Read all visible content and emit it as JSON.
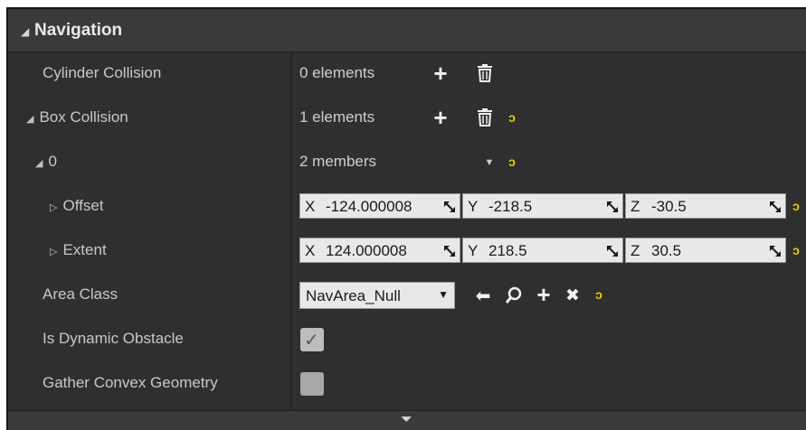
{
  "section": {
    "title": "Navigation"
  },
  "rows": {
    "cylinder": {
      "label": "Cylinder Collision",
      "value": "0 elements"
    },
    "box": {
      "label": "Box Collision",
      "value": "1 elements"
    },
    "element0": {
      "label": "0",
      "value": "2 members"
    },
    "offset": {
      "label": "Offset",
      "x": "-124.000008",
      "y": "-218.5",
      "z": "-30.5"
    },
    "extent": {
      "label": "Extent",
      "x": "124.000008",
      "y": "218.5",
      "z": "30.5"
    },
    "area_class": {
      "label": "Area Class",
      "selected": "NavArea_Null"
    },
    "dynamic": {
      "label": "Is Dynamic Obstacle",
      "checked": true
    },
    "convex": {
      "label": "Gather Convex Geometry",
      "checked": false
    }
  },
  "axes": {
    "x": "X",
    "y": "Y",
    "z": "Z"
  },
  "glyphs": {
    "expanded": "◢",
    "collapsed": "▷",
    "plus": "+",
    "reset": "ↄ",
    "dropdown": "▼",
    "small_dropdown": "▼",
    "back": "⬅",
    "clear": "✖",
    "check": "✓",
    "footer": "⏷"
  },
  "icons": {
    "add": "plus-icon",
    "delete": "trash-icon",
    "reset": "reset-to-default-icon",
    "back": "arrow-left-icon",
    "browse": "search-icon",
    "clear": "clear-icon",
    "drag": "drag-resize-icon"
  },
  "colors": {
    "panel": "#2f2f2f",
    "header": "#3a3a3a",
    "reset": "#e6d000",
    "field": "#e8e8e8"
  }
}
